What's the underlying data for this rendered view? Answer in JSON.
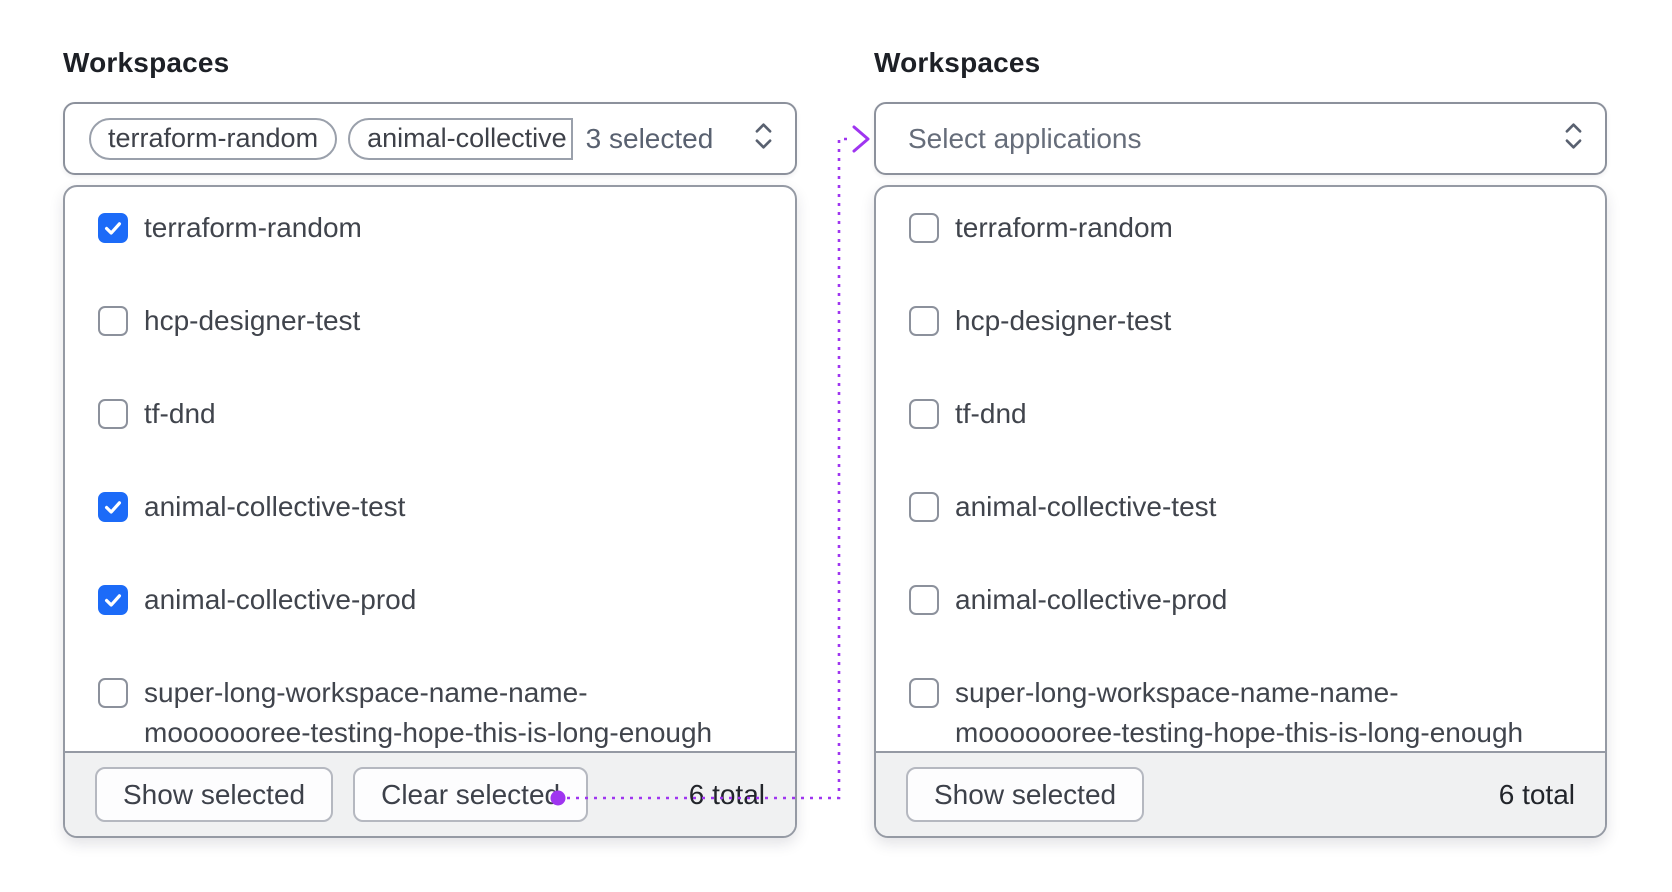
{
  "colors": {
    "checkbox_checked": "#1c6bf8",
    "connector": "#9f35f0"
  },
  "left": {
    "label": "Workspaces",
    "trigger": {
      "tags": [
        {
          "label": "terraform-random"
        },
        {
          "label": "animal-collective"
        }
      ],
      "count": "3 selected",
      "chevron_icon": "chevron-up-down"
    },
    "options": [
      {
        "label": "terraform-random",
        "checked": true
      },
      {
        "label": "hcp-designer-test",
        "checked": false
      },
      {
        "label": "tf-dnd",
        "checked": false
      },
      {
        "label": "animal-collective-test",
        "checked": true
      },
      {
        "label": "animal-collective-prod",
        "checked": true
      },
      {
        "label": "super-long-workspace-name-name-mooooooree-testing-hope-this-is-long-enough",
        "checked": false
      }
    ],
    "footer": {
      "show_button": "Show selected",
      "clear_button": "Clear selected",
      "total": "6 total"
    }
  },
  "right": {
    "label": "Workspaces",
    "trigger": {
      "placeholder": "Select applications",
      "chevron_icon": "chevron-up-down"
    },
    "options": [
      {
        "label": "terraform-random",
        "checked": false
      },
      {
        "label": "hcp-designer-test",
        "checked": false
      },
      {
        "label": "tf-dnd",
        "checked": false
      },
      {
        "label": "animal-collective-test",
        "checked": false
      },
      {
        "label": "animal-collective-prod",
        "checked": false
      },
      {
        "label": "super-long-workspace-name-name-mooooooree-testing-hope-this-is-long-enough",
        "checked": false
      }
    ],
    "footer": {
      "show_button": "Show selected",
      "total": "6 total"
    }
  }
}
